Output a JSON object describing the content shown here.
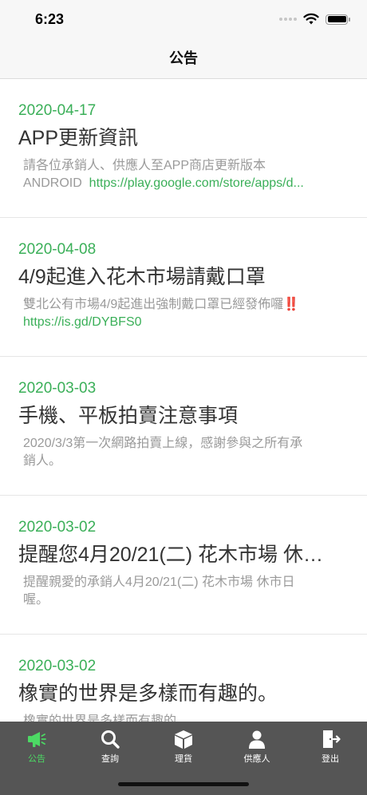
{
  "status": {
    "time": "6:23"
  },
  "nav": {
    "title": "公告"
  },
  "announcements": [
    {
      "date": "2020-04-17",
      "title": "APP更新資訊",
      "body_line1": "請各位承銷人、供應人至APP商店更新版本",
      "body_prefix": "ANDROID",
      "body_link": "https://play.google.com/store/apps/d..."
    },
    {
      "date": "2020-04-08",
      "title": "4/9起進入花木市場請戴口罩",
      "body_line1": "雙北公有市場4/9起進出強制戴口罩已經發佈囉‼️",
      "body_link": "https://is.gd/DYBFS0"
    },
    {
      "date": "2020-03-03",
      "title": "手機、平板拍賣注意事項",
      "body_line1": "2020/3/3第一次網路拍賣上線，感謝參與之所有承",
      "body_line2": "銷人。"
    },
    {
      "date": "2020-03-02",
      "title": "提醒您4月20/21(二) 花木市場 休…",
      "body_line1": "提醒親愛的承銷人4月20/21(二) 花木市場 休市日",
      "body_line2": "喔。"
    },
    {
      "date": "2020-03-02",
      "title": "橡實的世界是多樣而有趣的。",
      "body_line1": "橡實的世界是多樣而有趣的"
    }
  ],
  "tabs": [
    {
      "label": "公告",
      "icon": "megaphone-icon"
    },
    {
      "label": "查詢",
      "icon": "search-icon"
    },
    {
      "label": "理貨",
      "icon": "box-icon"
    },
    {
      "label": "供應人",
      "icon": "person-icon"
    },
    {
      "label": "登出",
      "icon": "logout-icon"
    }
  ],
  "colors": {
    "accent": "#3aaf58",
    "tab_active": "#4cd964",
    "tab_bar": "#555555"
  }
}
